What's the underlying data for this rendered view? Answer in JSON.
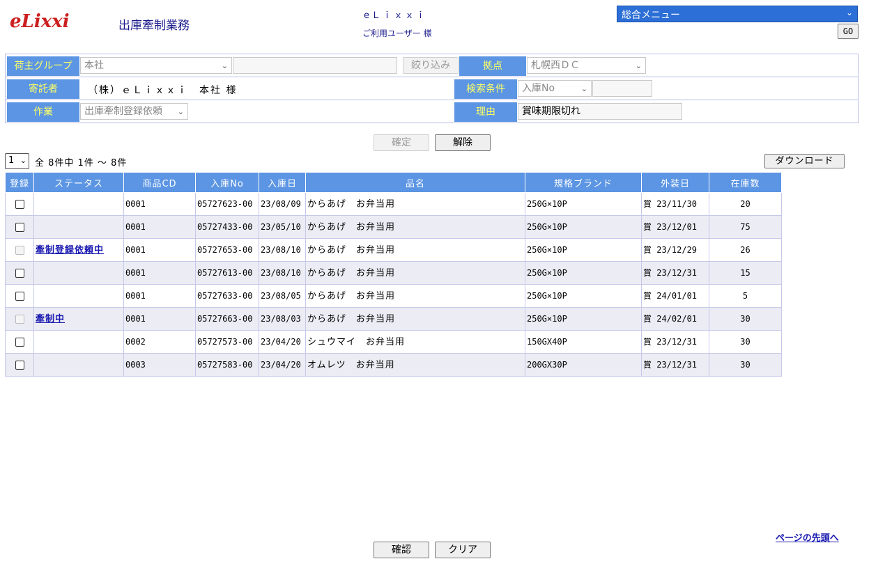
{
  "header": {
    "logo": "eLixxi",
    "page_title": "出庫牽制業務",
    "company": "eＬｉｘｘｉ",
    "user": "ご利用ユーザー 様",
    "menu_select": "総合メニュー",
    "go_label": "GO"
  },
  "filters": {
    "shipper_group_label": "荷主グループ",
    "shipper_group_value": "本社",
    "shipper_group_text": "",
    "narrow_button": "絞り込み",
    "site_label": "拠点",
    "site_value": "札幌西ＤＣ",
    "consignor_label": "寄託者",
    "consignor_value": "（株）ｅＬｉｘｘｉ　本社 様",
    "search_label": "検索条件",
    "search_field": "入庫No",
    "search_value": "",
    "work_label": "作業",
    "work_value": "出庫牽制登録依頼",
    "reason_label": "理由",
    "reason_value": "賞味期限切れ"
  },
  "actions": {
    "confirm_disabled": "確定",
    "release": "解除",
    "download": "ダウンロード",
    "check": "確認",
    "clear": "クリア",
    "top_link": "ページの先頭へ"
  },
  "pager": {
    "page": "1",
    "summary": "全 8件中 1件 ～ 8件"
  },
  "table": {
    "columns": [
      "登録",
      "ステータス",
      "商品CD",
      "入庫No",
      "入庫日",
      "品名",
      "規格ブランド",
      "外装日",
      "在庫数"
    ],
    "rows": [
      {
        "enabled": true,
        "status": "",
        "code": "0001",
        "no": "05727623-00",
        "date": "23/08/09",
        "name": "からあげ　お弁当用",
        "spec": "250G×10P",
        "outer": "賞 23/11/30",
        "qty": "20"
      },
      {
        "enabled": true,
        "status": "",
        "code": "0001",
        "no": "05727433-00",
        "date": "23/05/10",
        "name": "からあげ　お弁当用",
        "spec": "250G×10P",
        "outer": "賞 23/12/01",
        "qty": "75"
      },
      {
        "enabled": false,
        "status": "牽制登録依頼中",
        "code": "0001",
        "no": "05727653-00",
        "date": "23/08/10",
        "name": "からあげ　お弁当用",
        "spec": "250G×10P",
        "outer": "賞 23/12/29",
        "qty": "26"
      },
      {
        "enabled": true,
        "status": "",
        "code": "0001",
        "no": "05727613-00",
        "date": "23/08/10",
        "name": "からあげ　お弁当用",
        "spec": "250G×10P",
        "outer": "賞 23/12/31",
        "qty": "15"
      },
      {
        "enabled": true,
        "status": "",
        "code": "0001",
        "no": "05727633-00",
        "date": "23/08/05",
        "name": "からあげ　お弁当用",
        "spec": "250G×10P",
        "outer": "賞 24/01/01",
        "qty": "5"
      },
      {
        "enabled": false,
        "status": "牽制中",
        "code": "0001",
        "no": "05727663-00",
        "date": "23/08/03",
        "name": "からあげ　お弁当用",
        "spec": "250G×10P",
        "outer": "賞 24/02/01",
        "qty": "30"
      },
      {
        "enabled": true,
        "status": "",
        "code": "0002",
        "no": "05727573-00",
        "date": "23/04/20",
        "name": "シュウマイ　お弁当用",
        "spec": "150GX40P",
        "outer": "賞 23/12/31",
        "qty": "30"
      },
      {
        "enabled": true,
        "status": "",
        "code": "0003",
        "no": "05727583-00",
        "date": "23/04/20",
        "name": "オムレツ　お弁当用",
        "spec": "200GX30P",
        "outer": "賞 23/12/31",
        "qty": "30"
      }
    ]
  }
}
